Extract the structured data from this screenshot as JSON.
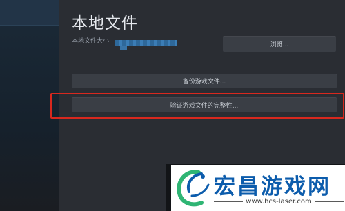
{
  "settings": {
    "title": "本地文件",
    "size_label": "本地文件大小:",
    "browse_label": "浏览...",
    "backup_label": "备份游戏文件...",
    "verify_label": "验证游戏文件的完整性..."
  },
  "watermark": {
    "brand": "宏昌游戏网",
    "url": "www.hcs-laser.com"
  },
  "colors": {
    "highlight_border": "#d8281e",
    "brand_blue": "#0c5cac",
    "brand_green": "#2fb574",
    "size_bar": "#3d86c4"
  }
}
